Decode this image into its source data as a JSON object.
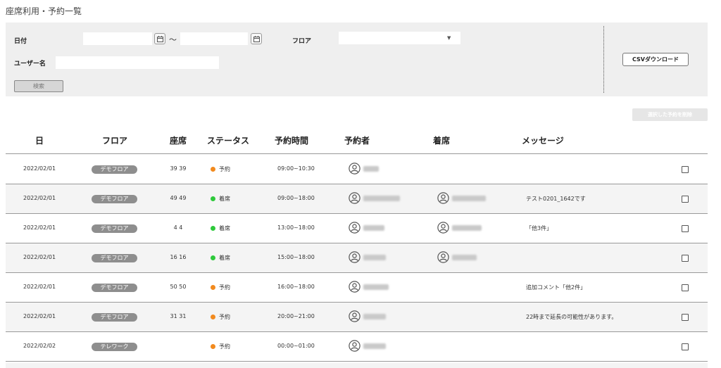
{
  "page": {
    "title": "座席利用・予約一覧"
  },
  "filters": {
    "date_label": "日付",
    "date_from": "",
    "date_to": "",
    "range_sep": "～",
    "floor_label": "フロア",
    "floor_value": "",
    "username_label": "ユーザー名",
    "username_value": "",
    "search_label": "検索",
    "csv_label": "CSVダウンロード"
  },
  "delete_selected_label": "選択した予約を削除",
  "colors": {
    "reserved": "#f28a1e",
    "attended": "#2ec93b",
    "badge": "#8e8e8e"
  },
  "table": {
    "headers": {
      "date": "日",
      "floor": "フロア",
      "seat": "座席",
      "status": "ステータス",
      "time": "予約時間",
      "reserver": "予約者",
      "attendee": "着席",
      "message": "メッセージ"
    },
    "rows": [
      {
        "date": "2022/02/01",
        "floor": "デモフロア",
        "seat": "39 39",
        "status": "予約",
        "status_color": "reserved",
        "time": "09:00~10:30",
        "reserver": true,
        "attendee": false,
        "message": "",
        "checked": false
      },
      {
        "date": "2022/02/01",
        "floor": "デモフロア",
        "seat": "49 49",
        "status": "着席",
        "status_color": "attended",
        "time": "09:00~18:00",
        "reserver": true,
        "attendee": true,
        "message": "テスト0201_1642です",
        "checked": false
      },
      {
        "date": "2022/02/01",
        "floor": "デモフロア",
        "seat": "4 4",
        "status": "着席",
        "status_color": "attended",
        "time": "13:00~18:00",
        "reserver": true,
        "attendee": true,
        "message": "「他3件」",
        "checked": false
      },
      {
        "date": "2022/02/01",
        "floor": "デモフロア",
        "seat": "16 16",
        "status": "着席",
        "status_color": "attended",
        "time": "15:00~18:00",
        "reserver": true,
        "attendee": true,
        "message": "",
        "checked": false
      },
      {
        "date": "2022/02/01",
        "floor": "デモフロア",
        "seat": "50 50",
        "status": "予約",
        "status_color": "reserved",
        "time": "16:00~18:00",
        "reserver": true,
        "attendee": false,
        "message": "追加コメント「他2件」",
        "checked": false
      },
      {
        "date": "2022/02/01",
        "floor": "デモフロア",
        "seat": "31 31",
        "status": "予約",
        "status_color": "reserved",
        "time": "20:00~21:00",
        "reserver": true,
        "attendee": false,
        "message": "22時まで延長の可能性があります。",
        "checked": false
      },
      {
        "date": "2022/02/02",
        "floor": "テレワーク",
        "seat": "",
        "status": "予約",
        "status_color": "reserved",
        "time": "00:00~01:00",
        "reserver": true,
        "attendee": false,
        "message": "",
        "checked": false
      }
    ]
  }
}
